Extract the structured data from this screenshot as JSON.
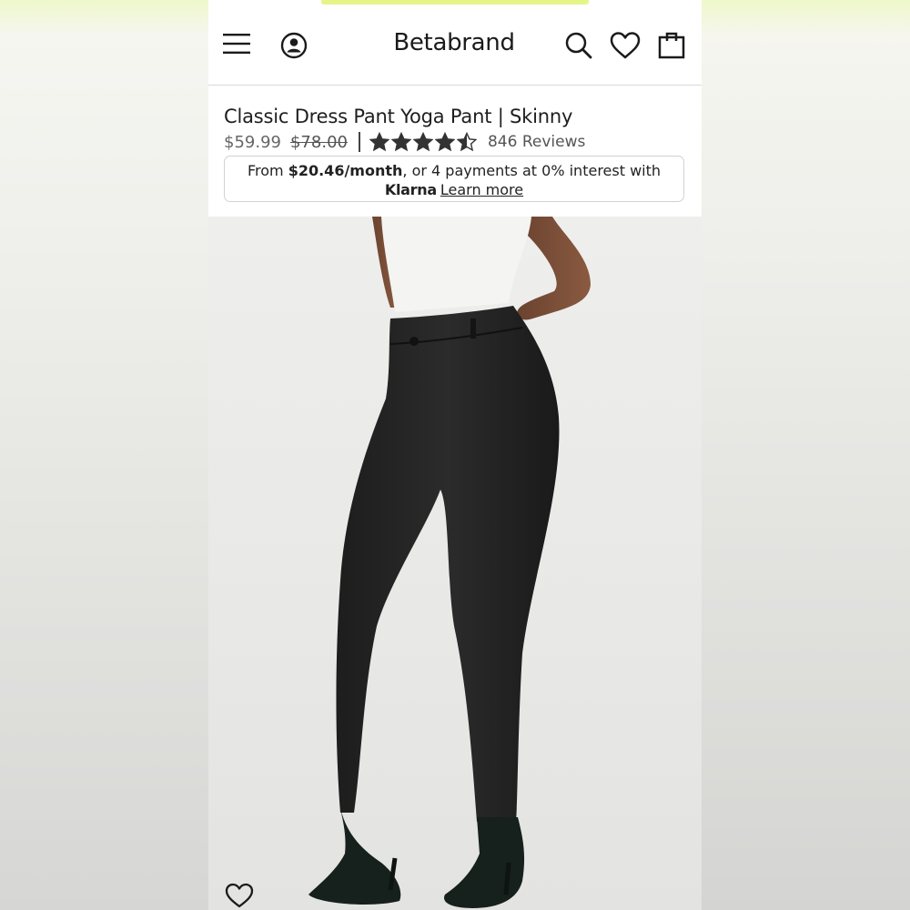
{
  "colors": {
    "promo_accent": "#e6f58a",
    "text_primary": "#1e1e1e",
    "star": "#333333"
  },
  "header": {
    "menu_icon": "hamburger-menu-icon",
    "account_icon": "user-account-icon",
    "logo": "Betabrand",
    "search_icon": "search-icon",
    "wishlist_icon": "heart-icon",
    "cart_icon": "shopping-bag-icon"
  },
  "product": {
    "title": "Classic Dress Pant Yoga Pant | Skinny",
    "sale_price": "$59.99",
    "original_price": "$78.00",
    "rating": 4.5,
    "rating_max": 5,
    "reviews": "846 Reviews"
  },
  "klarna": {
    "prefix": "From ",
    "amount": "$20.46/month",
    "suffix": ", or 4 payments at 0% interest with",
    "brand": "Klarna",
    "link": "Learn more"
  },
  "image": {
    "wishlist_icon": "heart-outline-icon"
  }
}
